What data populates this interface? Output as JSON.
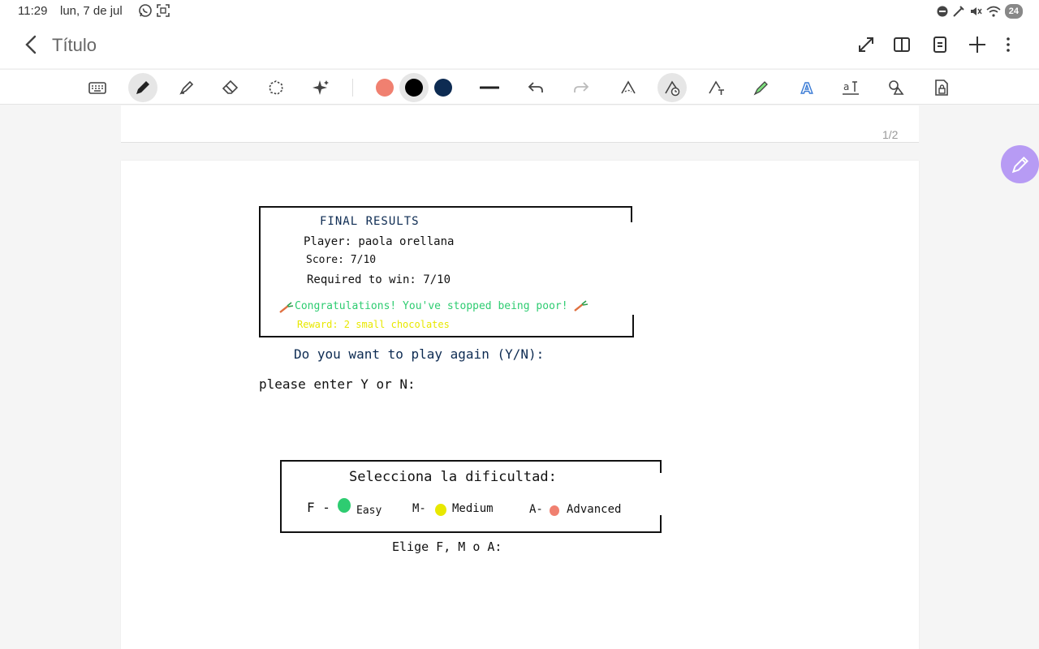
{
  "status": {
    "time": "11:29",
    "date": "lun, 7 de jul",
    "battery": "24"
  },
  "header": {
    "title": "Título"
  },
  "toolbar": {
    "pen_colors": [
      "#f08070",
      "#000000",
      "#0d2b52"
    ]
  },
  "page_indicator": "1/2",
  "note": {
    "final_title": "FINAL RESULTS",
    "player": "Player: paola orellana",
    "score": "Score:  7/10",
    "required": "Required to win: 7/10",
    "congrats": "Congratulations! You've stopped being poor!",
    "reward": "Reward: 2 small chocolates",
    "play_again": "Do you want to play again (Y/N):",
    "please_enter": "please enter Y or N:",
    "difficulty_title": "Selecciona la dificultad:",
    "opt_f_key": "F -",
    "opt_f_label": "Easy",
    "opt_m_key": "M-",
    "opt_m_label": "Medium",
    "opt_a_key": "A-",
    "opt_a_label": "Advanced",
    "elige": "Elige F, M o A:"
  },
  "colors": {
    "navy": "#0d2b52",
    "green": "#2ecc71",
    "yellow": "#e8e800",
    "salmon": "#f08070",
    "fab": "#b79bf4"
  }
}
